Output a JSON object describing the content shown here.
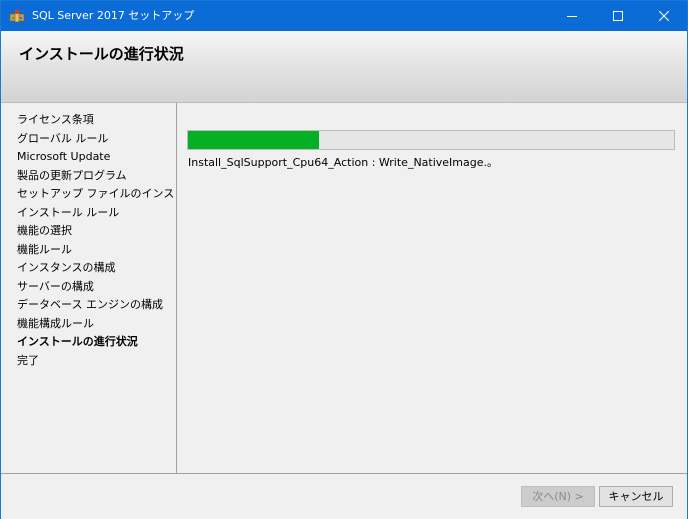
{
  "window": {
    "title": "SQL Server 2017 セットアップ",
    "icon": "sql-server-setup-icon",
    "controls": [
      "minimize-icon",
      "maximize-icon",
      "close-icon"
    ]
  },
  "header": {
    "title": "インストールの進行状況"
  },
  "sidebar": {
    "items": [
      {
        "label": "ライセンス条項",
        "active": false
      },
      {
        "label": "グローバル ルール",
        "active": false
      },
      {
        "label": "Microsoft Update",
        "active": false
      },
      {
        "label": "製品の更新プログラム",
        "active": false
      },
      {
        "label": "セットアップ ファイルのインストール",
        "active": false
      },
      {
        "label": "インストール ルール",
        "active": false
      },
      {
        "label": "機能の選択",
        "active": false
      },
      {
        "label": "機能ルール",
        "active": false
      },
      {
        "label": "インスタンスの構成",
        "active": false
      },
      {
        "label": "サーバーの構成",
        "active": false
      },
      {
        "label": "データベース エンジンの構成",
        "active": false
      },
      {
        "label": "機能構成ルール",
        "active": false
      },
      {
        "label": "インストールの進行状況",
        "active": true
      },
      {
        "label": "完了",
        "active": false
      }
    ]
  },
  "progress": {
    "percent": 27,
    "color": "#06b025",
    "status_text": "Install_SqlSupport_Cpu64_Action : Write_NativeImage.。"
  },
  "footer": {
    "next_label": "次へ(N) >",
    "next_enabled": false,
    "cancel_label": "キャンセル"
  },
  "colors": {
    "titlebar": "#0b6cd7",
    "progress_fill": "#06b025"
  }
}
